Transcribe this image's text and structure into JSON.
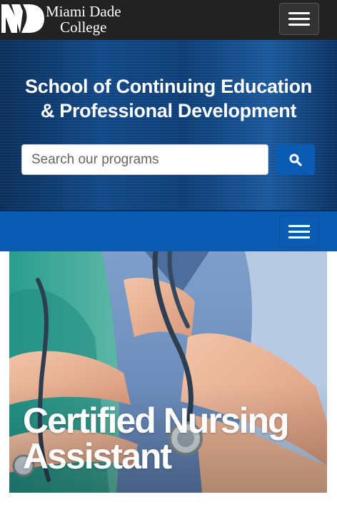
{
  "header": {
    "logo_line1": "Miami Dade",
    "logo_line2": "College",
    "menu_icon": "hamburger-icon"
  },
  "hero": {
    "title_line1": "School of Continuing Education",
    "title_line2": "& Professional Development",
    "search_placeholder": "Search our programs",
    "search_icon": "search-icon"
  },
  "nav": {
    "menu_icon": "hamburger-icon"
  },
  "feature": {
    "title_line1": "Certified Nursing",
    "title_line2": "Assistant"
  },
  "colors": {
    "header_bg": "#222222",
    "brand_blue": "#0a5bb2",
    "hero_blue": "#114a8a"
  }
}
